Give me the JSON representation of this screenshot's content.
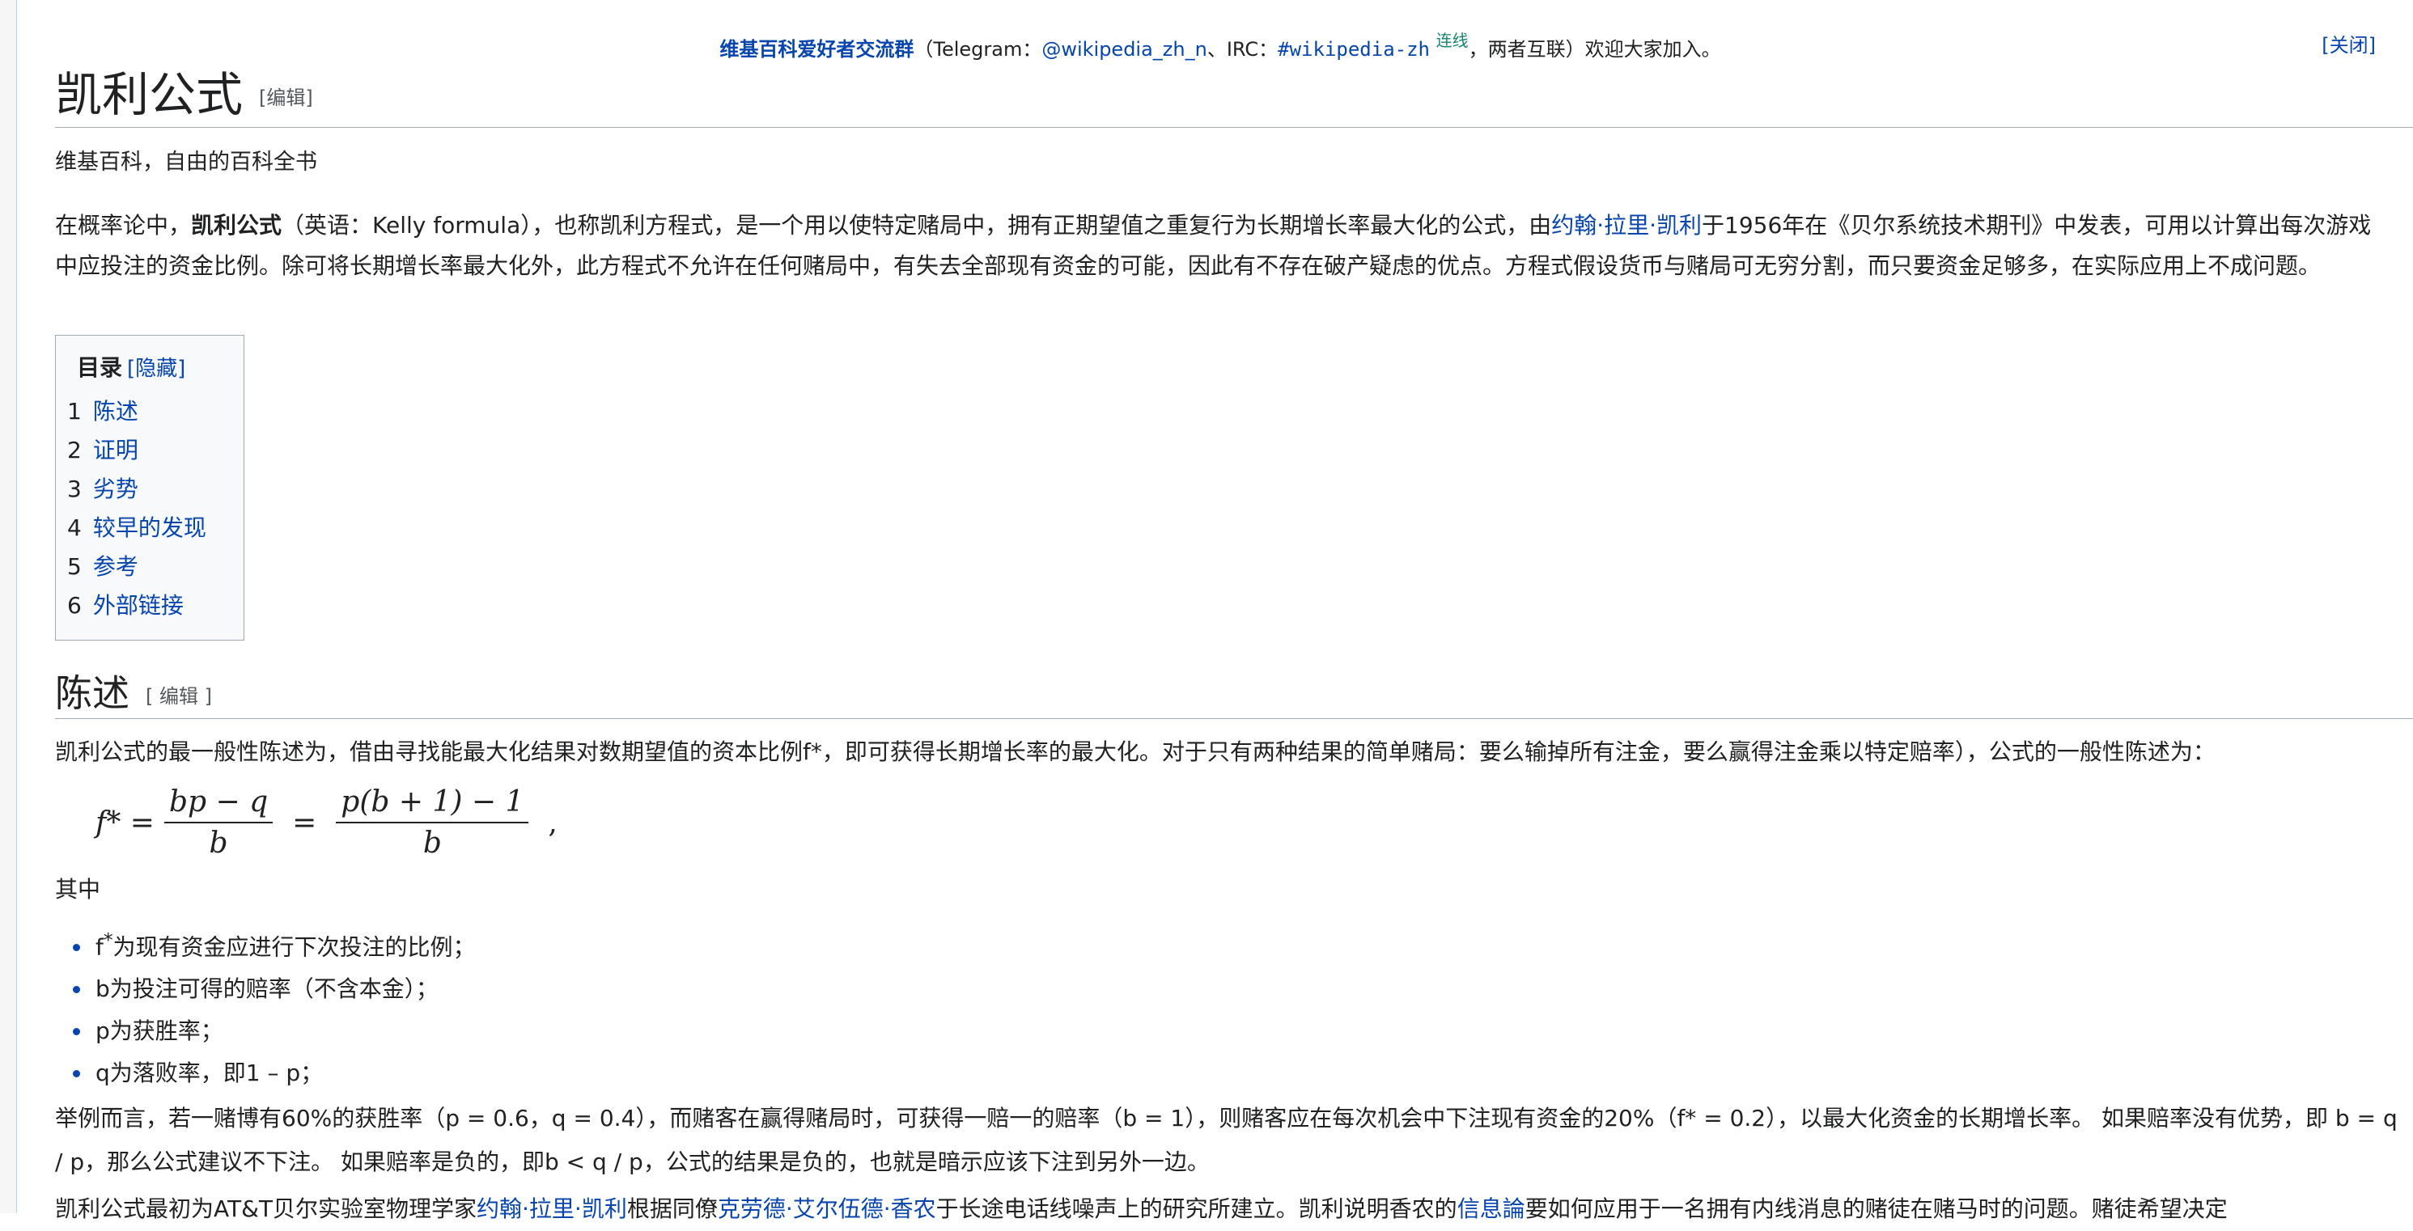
{
  "sitenotice": {
    "group_name": "维基百科爱好者交流群",
    "paren_open": "（Telegram：",
    "telegram_handle": "@wikipedia_zh_n",
    "irc_sep": "、IRC：",
    "irc_channel": "#wikipedia-zh",
    "connected": "连线",
    "rest": "，两者互联）欢迎大家加入。",
    "close": "[关闭]"
  },
  "article": {
    "title": "凯利公式",
    "edit_label": "[编辑]",
    "tagline": "维基百科，自由的百科全书"
  },
  "lead": {
    "t1": "在概率论中，",
    "bold": "凯利公式",
    "t2": "（英语：Kelly formula），也称凯利方程式，是一个用以使特定赌局中，拥有正期望值之重复行为长期增长率最大化的公式，由",
    "link_kelly": "约翰·拉里·凯利",
    "t3": "于1956年在《贝尔系统技术期刊》中发表，可用以计算出每次游戏中应投注的资金比例。除可将长期增长率最大化外，此方程式不允许在任何赌局中，有失去全部现有资金的可能，因此有不存在破产疑虑的优点。方程式假设货币与赌局可无穷分割，而只要资金足够多，在实际应用上不成问题。"
  },
  "toc": {
    "title": "目录",
    "hide": "[隐藏]",
    "items": [
      {
        "num": "1",
        "label": "陈述"
      },
      {
        "num": "2",
        "label": "证明"
      },
      {
        "num": "3",
        "label": "劣势"
      },
      {
        "num": "4",
        "label": "较早的发现"
      },
      {
        "num": "5",
        "label": "参考"
      },
      {
        "num": "6",
        "label": "外部链接"
      }
    ]
  },
  "section": {
    "title": "陈述",
    "edit_label": "[ 编辑 ]",
    "p1": "凯利公式的最一般性陈述为，借由寻找能最大化结果对数期望值的资本比例f*，即可获得长期增长率的最大化。对于只有两种结果的简单赌局：要么输掉所有注金，要么赢得注金乘以特定赔率），公式的一般性陈述为：",
    "formula": {
      "lhs": "f* =",
      "frac1_num": "bp − q",
      "frac1_den": "b",
      "eq": "=",
      "frac2_num": "p(b + 1) − 1",
      "frac2_den": "b",
      "tail": ","
    },
    "where": "其中",
    "defs": [
      {
        "pre": "f",
        "sup": "*",
        "text": "为现有资金应进行下次投注的比例；"
      },
      {
        "pre": "",
        "sup": "",
        "text": "b为投注可得的赔率（不含本金）；"
      },
      {
        "pre": "",
        "sup": "",
        "text": "p为获胜率；"
      },
      {
        "pre": "",
        "sup": "",
        "text": "q为落败率，即1 – p；"
      }
    ],
    "p2": "举例而言，若一赌博有60%的获胜率（p = 0.6，q = 0.4），而赌客在赢得赌局时，可获得一赔一的赔率（b = 1），则赌客应在每次机会中下注现有资金的20%（f* = 0.2），以最大化资金的长期增长率。 如果赔率没有优势，即 b = q / p，那么公式建议不下注。 如果赔率是负的，即b < q / p，公式的结果是负的，也就是暗示应该下注到另外一边。",
    "p3_a": "凯利公式最初为AT&T贝尔实验室物理学家",
    "p3_link1": "约翰·拉里·凯利",
    "p3_b": "根据同僚",
    "p3_link2": "克劳德·艾尔伍德·香农",
    "p3_c": "于长途电话线噪声上的研究所建立。凯利说明香农的",
    "p3_link3": "信息論",
    "p3_d": "要如何应用于一名拥有内线消息的赌徒在赌马时的问题。赌徒希望决定"
  }
}
